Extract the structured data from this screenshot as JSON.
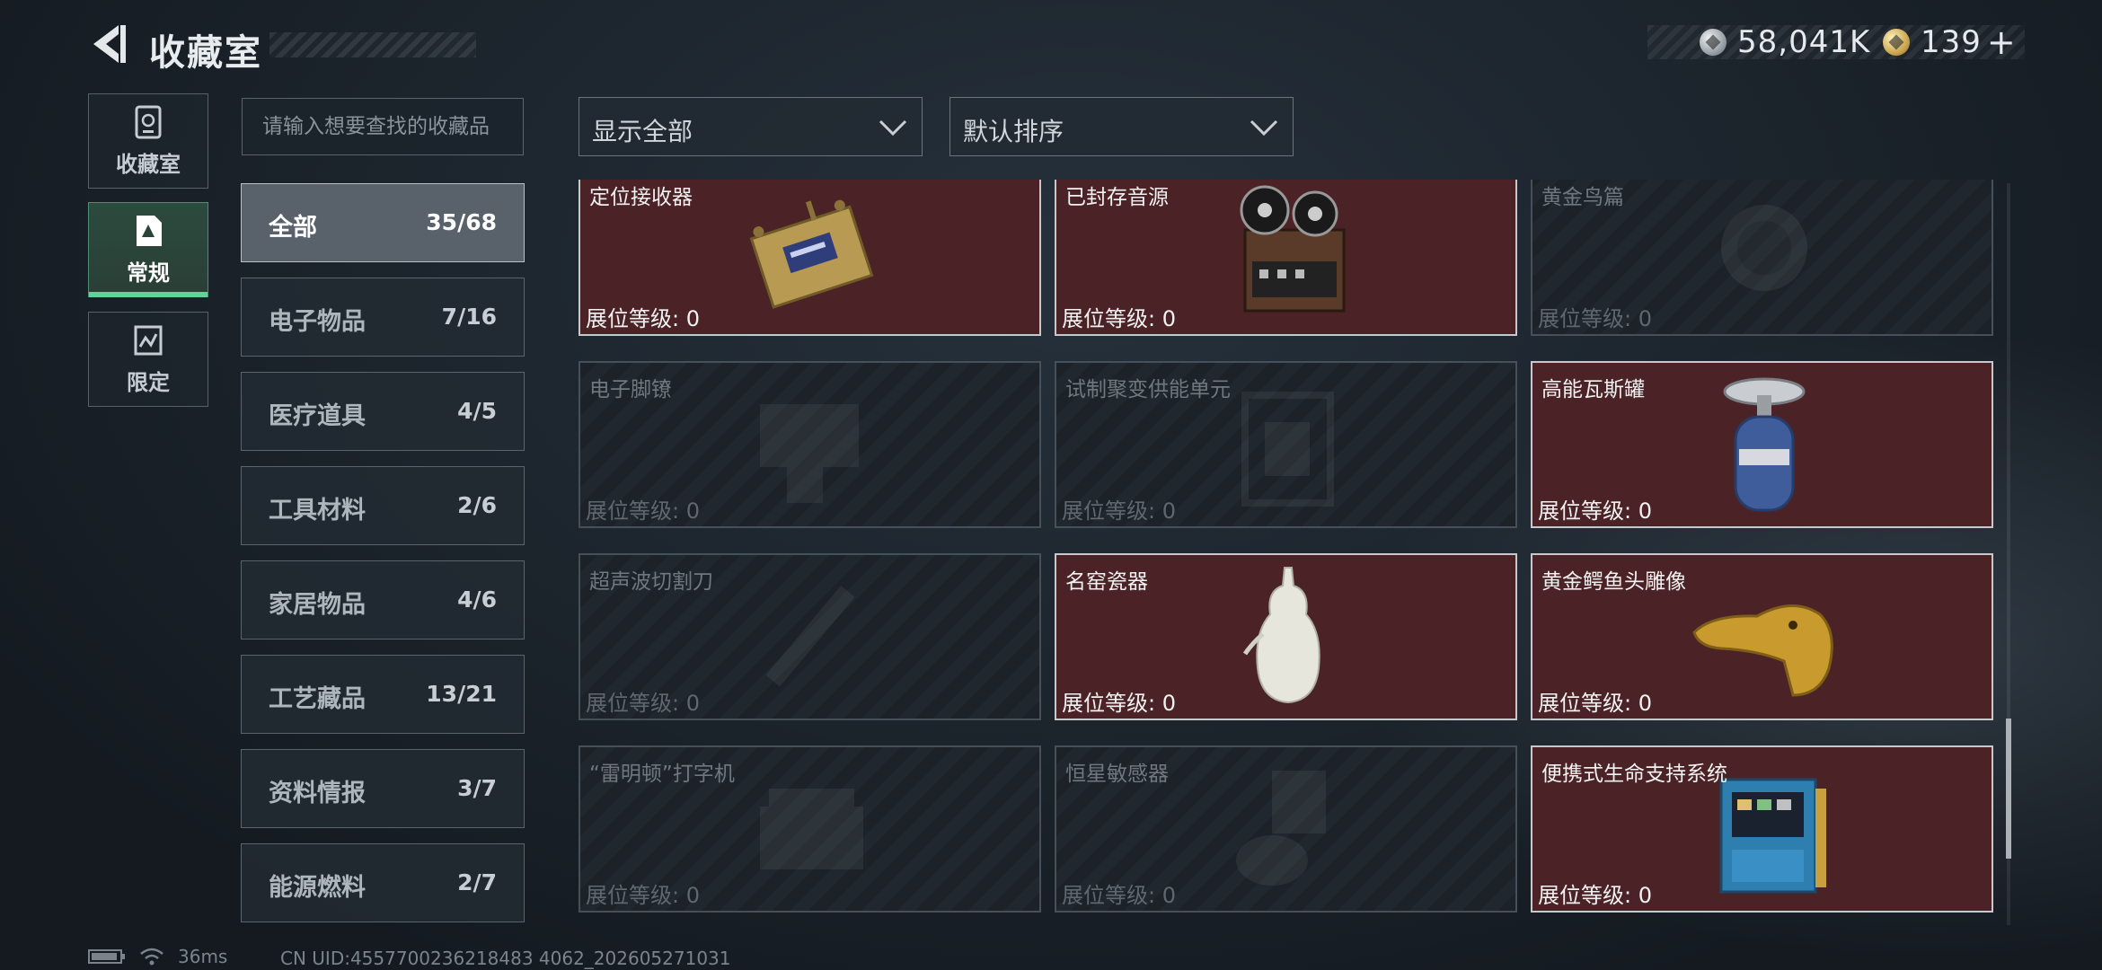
{
  "header": {
    "title": "收藏室",
    "currencies": [
      {
        "icon": "silver-coin-icon",
        "value": "58,041K"
      },
      {
        "icon": "gold-coin-icon",
        "value": "139"
      }
    ],
    "plus_label": "+"
  },
  "nav": {
    "items": [
      {
        "label": "收藏室",
        "icon": "storage-icon",
        "active": false
      },
      {
        "label": "常规",
        "icon": "document-icon",
        "active": true
      },
      {
        "label": "限定",
        "icon": "limited-icon",
        "active": false
      }
    ]
  },
  "search": {
    "placeholder": "请输入想要查找的收藏品",
    "value": ""
  },
  "categories": [
    {
      "name": "全部",
      "count": "35/68",
      "active": true
    },
    {
      "name": "电子物品",
      "count": "7/16"
    },
    {
      "name": "医疗道具",
      "count": "4/5"
    },
    {
      "name": "工具材料",
      "count": "2/6"
    },
    {
      "name": "家居物品",
      "count": "4/6"
    },
    {
      "name": "工艺藏品",
      "count": "13/21"
    },
    {
      "name": "资料情报",
      "count": "3/7"
    },
    {
      "name": "能源燃料",
      "count": "2/7"
    }
  ],
  "filters": {
    "show": "显示全部",
    "sort": "默认排序"
  },
  "grid": {
    "level_label": "展位等级: 0",
    "cards": [
      {
        "name": "定位接收器",
        "owned": true,
        "art": "receiver"
      },
      {
        "name": "已封存音源",
        "owned": true,
        "art": "tape"
      },
      {
        "name": "黄金鸟篇",
        "owned": false,
        "art": "emblem"
      },
      {
        "name": "电子脚镣",
        "owned": false,
        "art": "device"
      },
      {
        "name": "试制聚变供能单元",
        "owned": false,
        "art": "cube"
      },
      {
        "name": "高能瓦斯罐",
        "owned": true,
        "art": "gas"
      },
      {
        "name": "超声波切割刀",
        "owned": false,
        "art": "knife"
      },
      {
        "name": "名窑瓷器",
        "owned": true,
        "art": "vase"
      },
      {
        "name": "黄金鳄鱼头雕像",
        "owned": true,
        "art": "croc"
      },
      {
        "name": "“雷明顿”打字机",
        "owned": false,
        "art": "typewriter"
      },
      {
        "name": "恒星敏感器",
        "owned": false,
        "art": "sensor"
      },
      {
        "name": "便携式生命支持系统",
        "owned": true,
        "art": "lifesupport"
      }
    ]
  },
  "status": {
    "ping": "36ms",
    "uid": "CN UID:4557700236218483 4062_202605271031"
  }
}
